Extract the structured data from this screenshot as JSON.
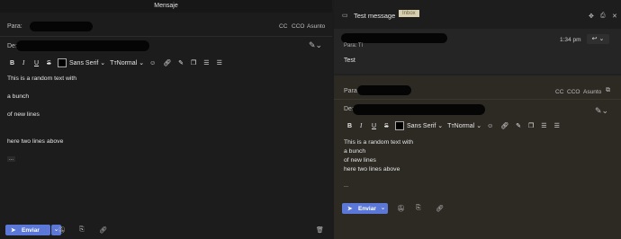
{
  "compose_left": {
    "title": "Mensaje",
    "to_label": "Para:",
    "from_label": "De:",
    "cc": "CC",
    "cco": "CCO",
    "asunto": "Asunto",
    "font_name": "Sans Serif",
    "size_name": "Normal",
    "body_lines": [
      "This is a random text with",
      "a bunch",
      "of new lines",
      "here two lines above"
    ],
    "ellipsis": "...",
    "send_label": "Enviar"
  },
  "message": {
    "subject": "Test message",
    "badge": "Inbox",
    "to_label": "Para: Tí",
    "time": "1:34 pm",
    "body": "Test"
  },
  "compose_right": {
    "to_label": "Para:",
    "from_label": "De:",
    "cc": "CC",
    "cco": "CCO",
    "asunto": "Asunto",
    "font_name": "Sans Serif",
    "size_name": "Normal",
    "body_lines": [
      "This is a random text with",
      "a bunch",
      "of new lines",
      "here two lines above"
    ],
    "ellipsis": "...",
    "send_label": "Enviar"
  },
  "colors": {
    "accent": "#5b78d8",
    "badge_bg": "#d8cfae"
  }
}
